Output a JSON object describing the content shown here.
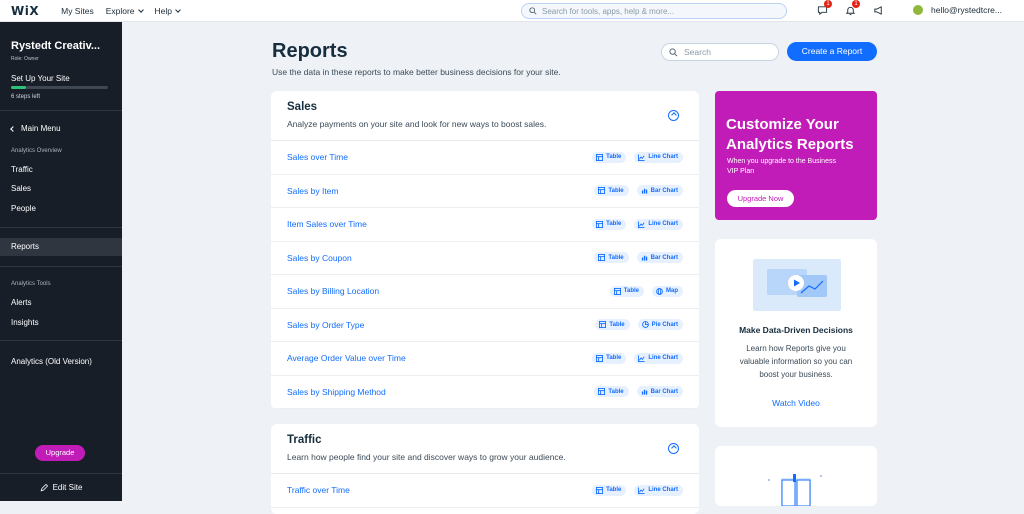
{
  "topbar": {
    "logo": "WiX",
    "nav": [
      "My Sites",
      "Explore",
      "Help"
    ],
    "search_placeholder": "Search for tools, apps, help & more...",
    "notifications_badge": "1",
    "alerts_badge": "1",
    "user_email": "hello@rystedtcre..."
  },
  "sidebar": {
    "site_name": "Rystedt Creativ...",
    "role": "Role: Owner",
    "setup_title": "Set Up Your Site",
    "setup_progress": 0.15,
    "steps_left": "6 steps left",
    "main_menu": "Main Menu",
    "section_overview": "Analytics Overview",
    "overview_items": [
      "Traffic",
      "Sales",
      "People"
    ],
    "reports": "Reports",
    "section_tools": "Analytics Tools",
    "tools_items": [
      "Alerts",
      "Insights"
    ],
    "old_version": "Analytics (Old Version)",
    "upgrade": "Upgrade",
    "edit_site": "Edit Site"
  },
  "header": {
    "title": "Reports",
    "subtitle": "Use the data in these reports to make better business decisions for your site.",
    "search_placeholder": "Search",
    "create_button": "Create a Report"
  },
  "sales": {
    "title": "Sales",
    "description": "Analyze payments on your site and look for new ways to boost sales.",
    "rows": [
      {
        "label": "Sales over Time",
        "chips": [
          "Table",
          "Line Chart"
        ]
      },
      {
        "label": "Sales by Item",
        "chips": [
          "Table",
          "Bar Chart"
        ]
      },
      {
        "label": "Item Sales over Time",
        "chips": [
          "Table",
          "Line Chart"
        ]
      },
      {
        "label": "Sales by Coupon",
        "chips": [
          "Table",
          "Bar Chart"
        ]
      },
      {
        "label": "Sales by Billing Location",
        "chips": [
          "Table",
          "Map"
        ]
      },
      {
        "label": "Sales by Order Type",
        "chips": [
          "Table",
          "Pie Chart"
        ]
      },
      {
        "label": "Average Order Value over Time",
        "chips": [
          "Table",
          "Line Chart"
        ]
      },
      {
        "label": "Sales by Shipping Method",
        "chips": [
          "Table",
          "Bar Chart"
        ]
      }
    ]
  },
  "traffic": {
    "title": "Traffic",
    "description": "Learn how people find your site and discover ways to grow your audience.",
    "rows": [
      {
        "label": "Traffic over Time",
        "chips": [
          "Table",
          "Line Chart"
        ]
      }
    ]
  },
  "promo": {
    "title": "Customize Your Analytics Reports",
    "text": "When you upgrade to the Business VIP Plan",
    "button": "Upgrade Now"
  },
  "video_card": {
    "title": "Make Data-Driven Decisions",
    "text": "Learn how Reports give you valuable information so you can boost your business.",
    "link": "Watch Video"
  },
  "colors": {
    "accent": "#116dff",
    "promo": "#c21cb8",
    "sidebar": "#171e28"
  }
}
